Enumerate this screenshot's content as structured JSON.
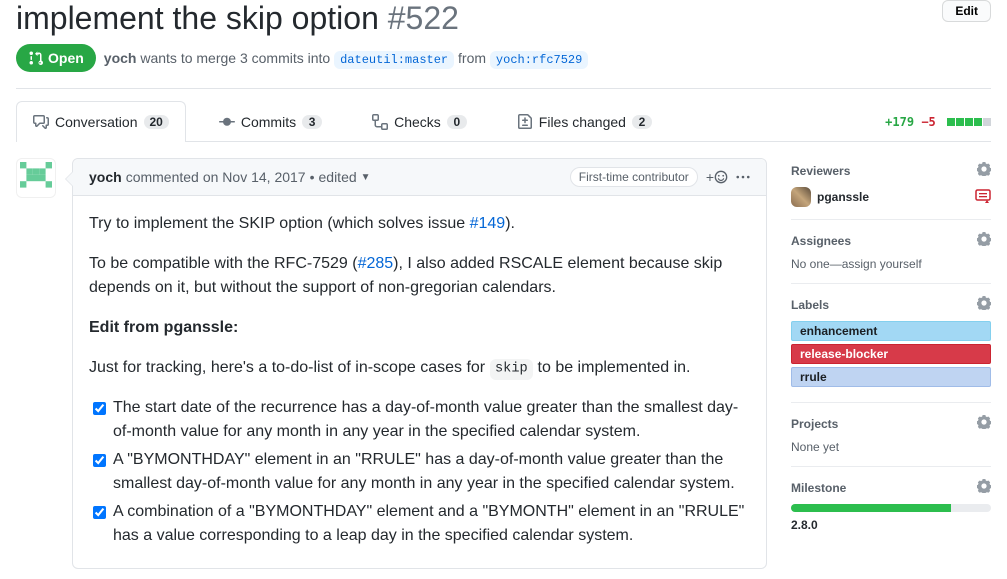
{
  "header": {
    "title": "implement the skip option",
    "number": "#522",
    "edit_label": "Edit"
  },
  "state": {
    "label": "Open"
  },
  "meta": {
    "author": "yoch",
    "action_prefix": "wants to merge 3 commits into",
    "base_branch": "dateutil:master",
    "from_word": "from",
    "head_branch": "yoch:rfc7529"
  },
  "tabs": {
    "conversation": {
      "label": "Conversation",
      "count": "20"
    },
    "commits": {
      "label": "Commits",
      "count": "3"
    },
    "checks": {
      "label": "Checks",
      "count": "0"
    },
    "files": {
      "label": "Files changed",
      "count": "2"
    }
  },
  "diff": {
    "additions": "+179",
    "deletions": "−5"
  },
  "comment": {
    "author": "yoch",
    "ts_prefix": "commented",
    "timestamp": "on Nov 14, 2017",
    "edited": "edited",
    "first_time": "First-time contributor",
    "p1_pre": "Try to implement the SKIP option (which solves issue ",
    "link1": "#149",
    "p1_post": ").",
    "p2_pre": "To be compatible with the RFC-7529 (",
    "link2": "#285",
    "p2_post": "), I also added RSCALE element because skip depends on it, but without the support of non-gregorian calendars.",
    "edit_heading": "Edit from pganssle:",
    "p3_pre": "Just for tracking, here's a to-do-list of in-scope cases for ",
    "code": "skip",
    "p3_post": " to be implemented in.",
    "tasks": [
      "The start date of the recurrence has a day-of-month value greater than the smallest day-of-month value for any month in any year in the specified calendar system.",
      "A \"BYMONTHDAY\" element in an \"RRULE\" has a day-of-month value greater than the smallest day-of-month value for any month in any year in the specified calendar system.",
      "A combination of a \"BYMONTHDAY\" element and a \"BYMONTH\" element in an \"RRULE\" has a value corresponding to a leap day in the specified calendar system."
    ]
  },
  "sidebar": {
    "reviewers": {
      "title": "Reviewers",
      "name": "pganssle"
    },
    "assignees": {
      "title": "Assignees",
      "text": "No one—assign yourself"
    },
    "labels": {
      "title": "Labels",
      "l1": "enhancement",
      "l2": "release-blocker",
      "l3": "rrule"
    },
    "projects": {
      "title": "Projects",
      "text": "None yet"
    },
    "milestone": {
      "title": "Milestone",
      "name": "2.8.0"
    }
  }
}
